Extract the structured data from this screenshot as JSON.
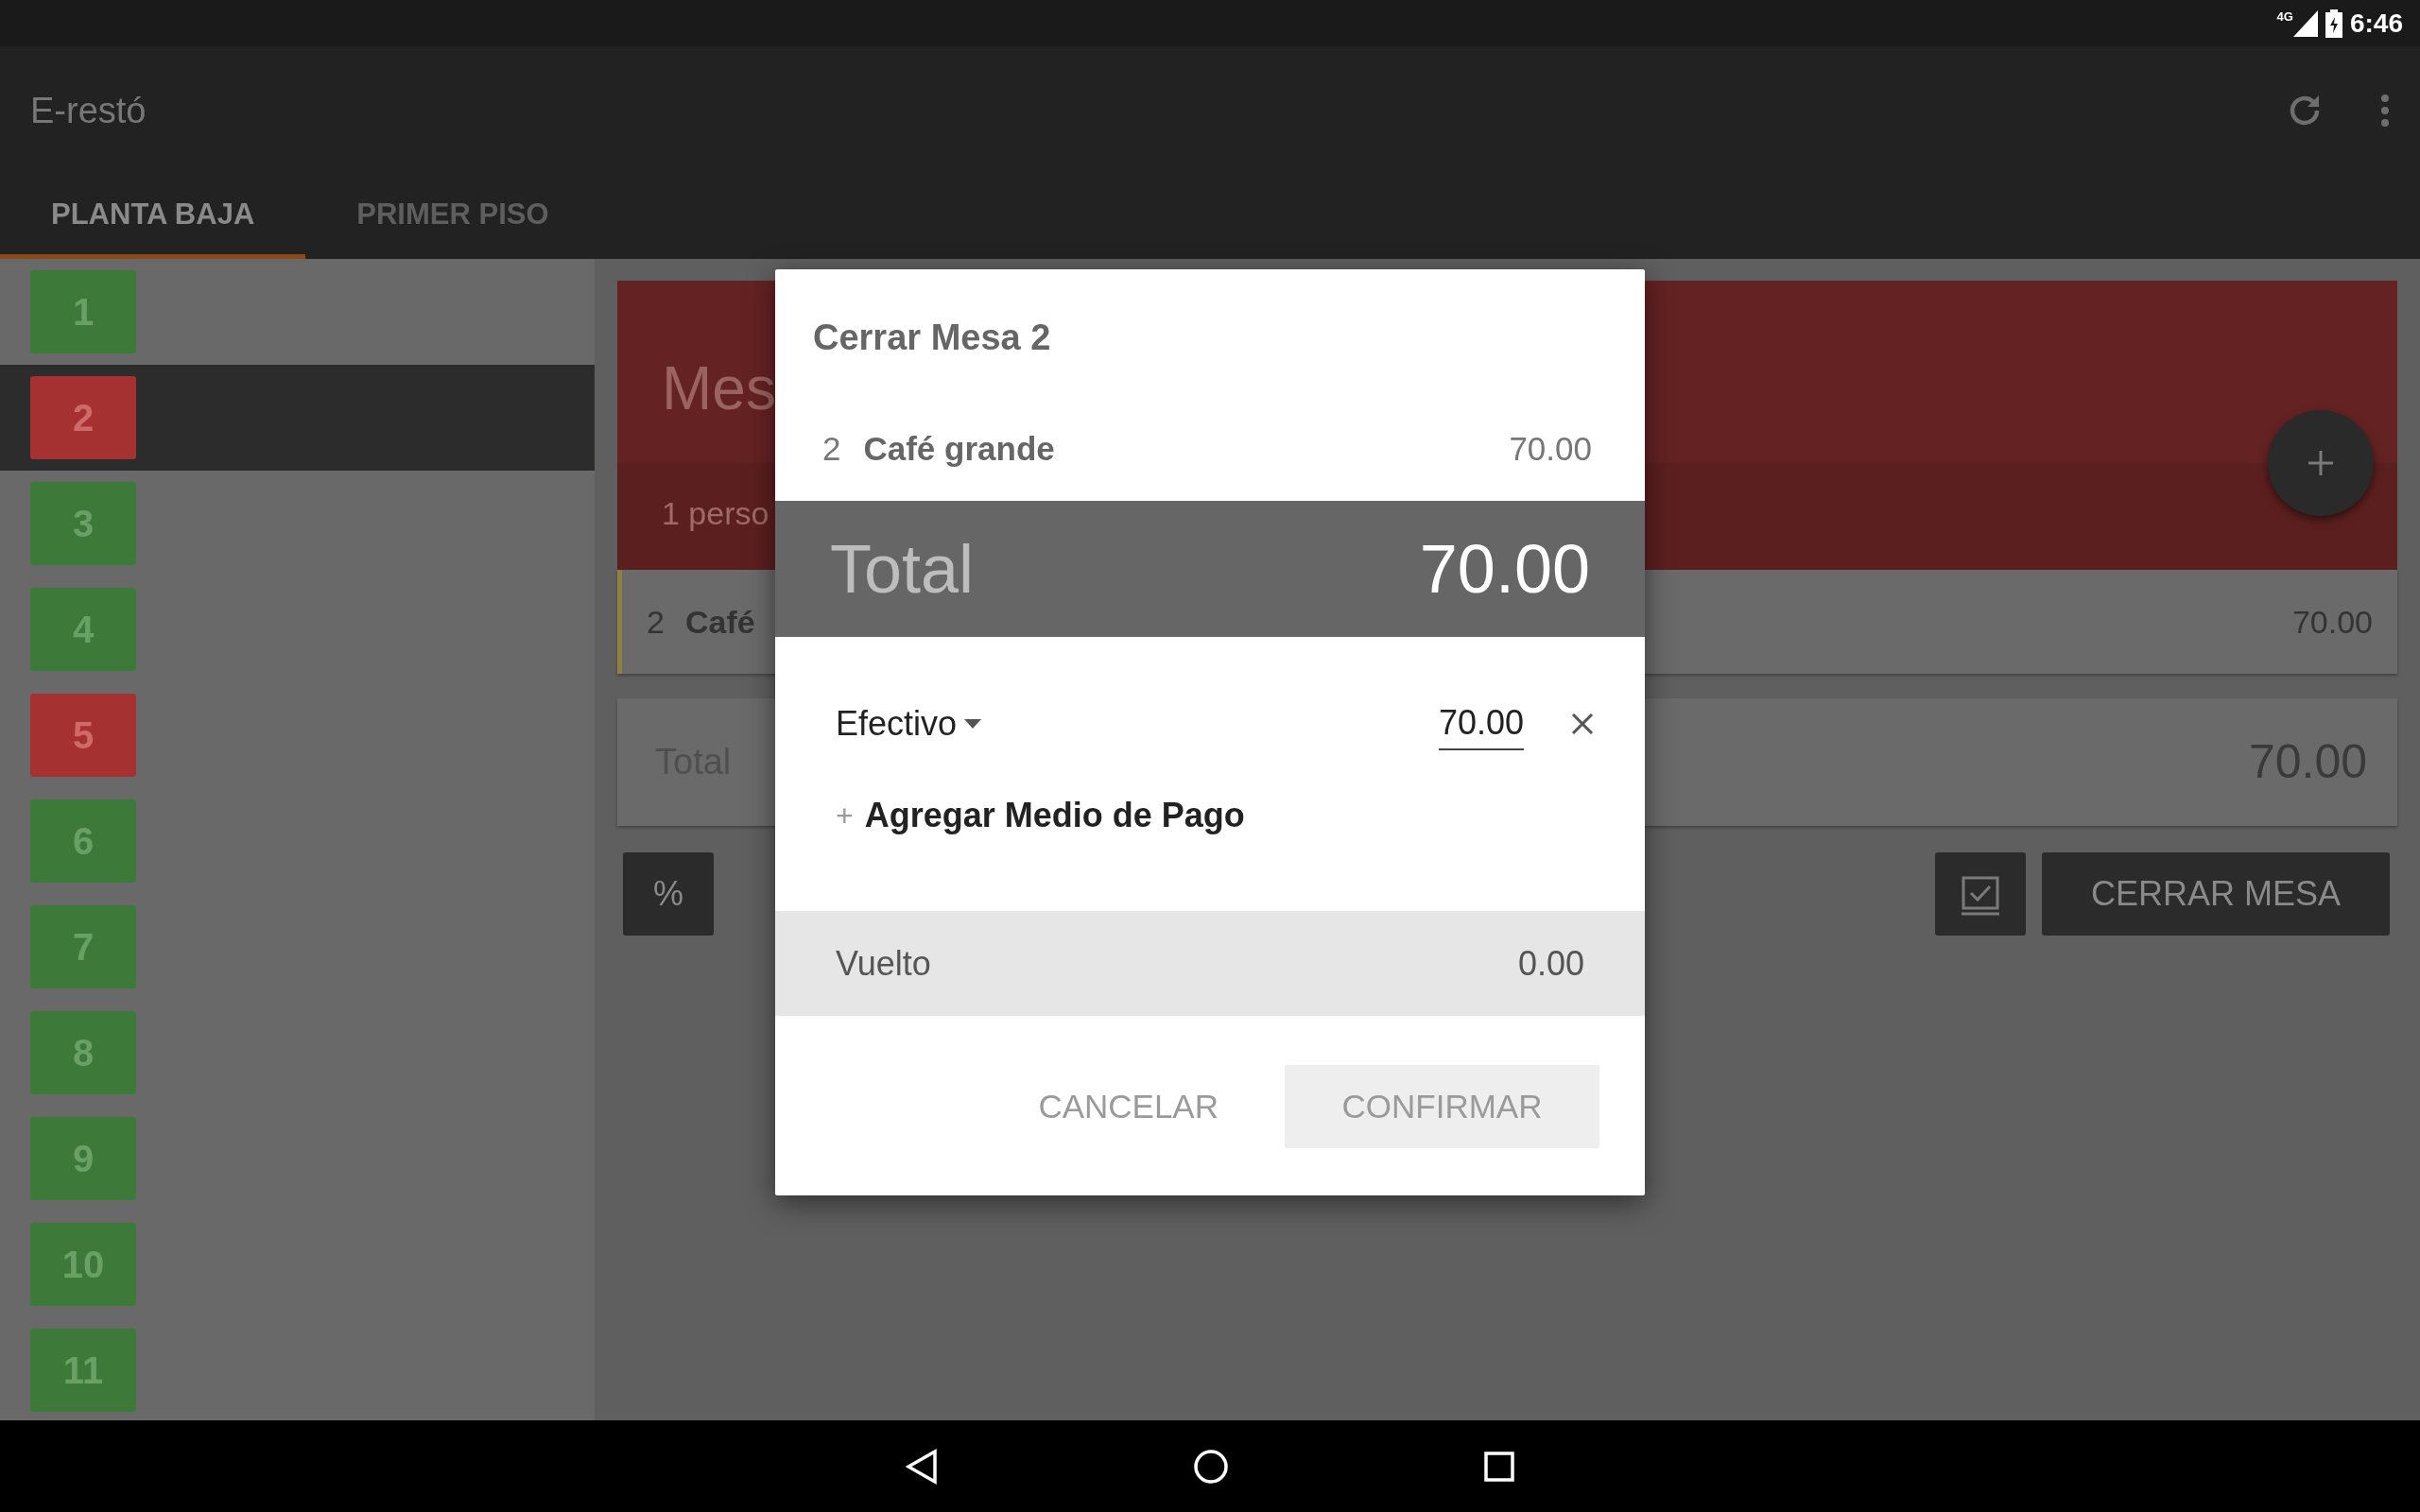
{
  "status_bar": {
    "network": "4G",
    "time": "6:46"
  },
  "app_bar": {
    "title": "E-restó"
  },
  "tabs": [
    {
      "label": "PLANTA BAJA",
      "selected": true
    },
    {
      "label": "PRIMER PISO",
      "selected": false
    }
  ],
  "tables": [
    {
      "number": "1",
      "occupied": false,
      "selected": false
    },
    {
      "number": "2",
      "occupied": true,
      "selected": true
    },
    {
      "number": "3",
      "occupied": false,
      "selected": false
    },
    {
      "number": "4",
      "occupied": false,
      "selected": false
    },
    {
      "number": "5",
      "occupied": true,
      "selected": false
    },
    {
      "number": "6",
      "occupied": false,
      "selected": false
    },
    {
      "number": "7",
      "occupied": false,
      "selected": false
    },
    {
      "number": "8",
      "occupied": false,
      "selected": false
    },
    {
      "number": "9",
      "occupied": false,
      "selected": false
    },
    {
      "number": "10",
      "occupied": false,
      "selected": false
    },
    {
      "number": "11",
      "occupied": false,
      "selected": false
    }
  ],
  "table_detail": {
    "title": "Mes",
    "subtitle": "1 perso",
    "items": [
      {
        "qty": "2",
        "name": "Café",
        "price": "70.00"
      }
    ],
    "total_label": "Total",
    "total": "70.00",
    "discount_button": "%",
    "close_button": "CERRAR MESA"
  },
  "dialog": {
    "title": "Cerrar Mesa 2",
    "items": [
      {
        "qty": "2",
        "name": "Café grande",
        "price": "70.00"
      }
    ],
    "total_label": "Total",
    "total": "70.00",
    "payments": [
      {
        "method": "Efectivo",
        "amount": "70.00"
      }
    ],
    "add_payment": "Agregar Medio de Pago",
    "add_icon": "+",
    "change_label": "Vuelto",
    "change": "0.00",
    "buttons": [
      {
        "label": "CANCELAR",
        "kind": "flat"
      },
      {
        "label": "CONFIRMAR",
        "kind": "raised"
      }
    ]
  }
}
